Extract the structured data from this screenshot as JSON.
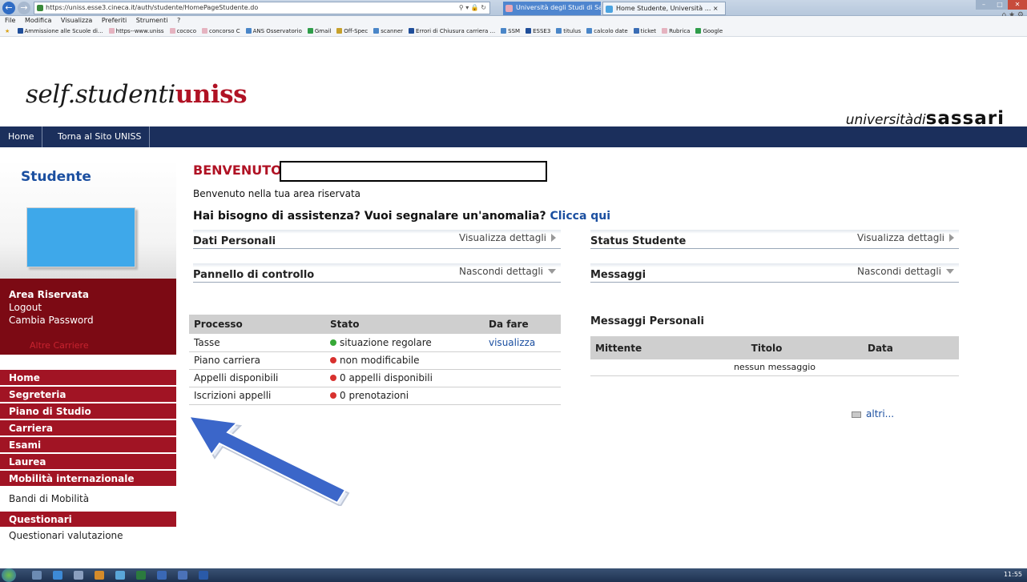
{
  "browser": {
    "url": "https://uniss.esse3.cineca.it/auth/studente/HomePageStudente.do",
    "tabs": [
      {
        "label": "Università degli Studi di Sassari"
      },
      {
        "label": "Home Studente, Università ... ×"
      }
    ],
    "menu": [
      "File",
      "Modifica",
      "Visualizza",
      "Preferiti",
      "Strumenti",
      "?"
    ],
    "favorites": [
      {
        "label": "Ammissione alle Scuole di...",
        "color": "#1f4e9a"
      },
      {
        "label": "https--www.uniss",
        "color": "#e5b3c0"
      },
      {
        "label": "cococo",
        "color": "#e5b3c0"
      },
      {
        "label": "concorso C",
        "color": "#e5b3c0"
      },
      {
        "label": "ANS Osservatorio",
        "color": "#4a86c8"
      },
      {
        "label": "Gmail",
        "color": "#2f9d4a"
      },
      {
        "label": "Off-Spec",
        "color": "#c7a12b"
      },
      {
        "label": "scanner",
        "color": "#4a86c8"
      },
      {
        "label": "Errori di Chiusura carriera ...",
        "color": "#1f4e9a"
      },
      {
        "label": "SSM",
        "color": "#4a86c8"
      },
      {
        "label": "ESSE3",
        "color": "#1f4e9a"
      },
      {
        "label": "titulus",
        "color": "#4a86c8"
      },
      {
        "label": "calcolo date",
        "color": "#4a86c8"
      },
      {
        "label": "ticket",
        "color": "#3a6db5"
      },
      {
        "label": "Rubrica",
        "color": "#e5b3c0"
      },
      {
        "label": "Google",
        "color": "#2f9d4a"
      }
    ],
    "clock": "11:55"
  },
  "header": {
    "logo_prefix": "self.studenti",
    "logo_brand": "uniss",
    "univ_italic": "universitàdi",
    "univ_bold": "sassari"
  },
  "navbar": {
    "home": "Home",
    "torna": "Torna al Sito UNISS"
  },
  "sidebar": {
    "title": "Studente",
    "area_riservata": "Area Riservata",
    "logout": "Logout",
    "cambia_password": "Cambia Password",
    "altre_carriere": "Altre Carriere",
    "menu": [
      "Home",
      "Segreteria",
      "Piano di Studio",
      "Carriera",
      "Esami",
      "Laurea",
      "Mobilità internazionale"
    ],
    "bandi": "Bandi di Mobilità",
    "questionari": "Questionari",
    "questionari_valutazione": "Questionari valutazione"
  },
  "main": {
    "welcome": "BENVENUTO",
    "subtitle": "Benvenuto nella tua area riservata",
    "help_text": "Hai bisogno di assistenza? Vuoi segnalare un'anomalia?",
    "help_link": "Clicca qui",
    "dati_personali": {
      "title": "Dati Personali",
      "action": "Visualizza dettagli"
    },
    "status_studente": {
      "title": "Status Studente",
      "action": "Visualizza dettagli"
    },
    "pannello": {
      "title": "Pannello di controllo",
      "action": "Nascondi dettagli"
    },
    "messaggi": {
      "title": "Messaggi",
      "action": "Nascondi dettagli"
    },
    "process_table": {
      "headers": [
        "Processo",
        "Stato",
        "Da fare"
      ],
      "rows": [
        {
          "processo": "Tasse",
          "stato": "situazione regolare",
          "status_color": "green",
          "da_fare": "visualizza"
        },
        {
          "processo": "Piano carriera",
          "stato": "non modificabile",
          "status_color": "red",
          "da_fare": ""
        },
        {
          "processo": "Appelli disponibili",
          "stato": "0 appelli disponibili",
          "status_color": "red",
          "da_fare": ""
        },
        {
          "processo": "Iscrizioni appelli",
          "stato": "0 prenotazioni",
          "status_color": "red",
          "da_fare": ""
        }
      ]
    },
    "messaggi_personali": {
      "title": "Messaggi Personali",
      "headers": [
        "Mittente",
        "Titolo",
        "Data"
      ],
      "empty": "nessun messaggio",
      "more": "altri..."
    }
  },
  "colors": {
    "brand_red": "#b01224",
    "nav_blue": "#1b2f5c",
    "link_blue": "#1b4fa0",
    "status_green": "#36a836",
    "status_red": "#d8312e",
    "arrow_blue": "#3b66c9"
  }
}
